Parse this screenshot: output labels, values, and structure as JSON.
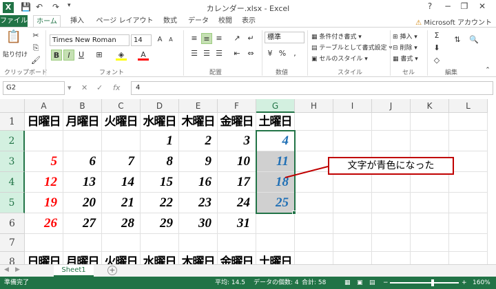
{
  "window": {
    "title": "カレンダー.xlsx - Excel",
    "logo": "X",
    "minimize": "−",
    "restore": "❐",
    "close": "✕",
    "help": "?"
  },
  "qat": {
    "save_icon": "save-icon",
    "undo_icon": "undo-icon",
    "redo_icon": "redo-icon"
  },
  "tabs": [
    "ファイル",
    "ホーム",
    "挿入",
    "ページ レイアウト",
    "数式",
    "データ",
    "校閲",
    "表示"
  ],
  "account": "Microsoft アカウント",
  "ribbon": {
    "clipboard": {
      "paste": "貼り付け",
      "label": "クリップボード"
    },
    "font": {
      "name": "Times New Roman",
      "size": "14",
      "bold": "B",
      "italic": "I",
      "underline": "U",
      "label": "フォント"
    },
    "alignment": {
      "label": "配置"
    },
    "number": {
      "format": "標準",
      "label": "数値"
    },
    "styles": {
      "conditional": "条件付き書式",
      "table": "テーブルとして書式設定",
      "cell": "セルのスタイル",
      "label": "スタイル"
    },
    "cells": {
      "insert": "挿入",
      "delete": "削除",
      "format": "書式",
      "label": "セル"
    },
    "editing": {
      "label": "編集"
    }
  },
  "formula_bar": {
    "namebox": "G2",
    "fx": "fx",
    "value": "4"
  },
  "grid": {
    "columns": [
      "A",
      "B",
      "C",
      "D",
      "E",
      "F",
      "G",
      "H",
      "I",
      "J",
      "K",
      "L"
    ],
    "rows": [
      "1",
      "2",
      "3",
      "4",
      "5",
      "6",
      "7",
      "8"
    ],
    "selected_column": "G",
    "selected_rows": [
      "2",
      "3",
      "4",
      "5"
    ],
    "weekdays": [
      "日曜日",
      "月曜日",
      "火曜日",
      "水曜日",
      "木曜日",
      "金曜日",
      "土曜日"
    ],
    "weeks": [
      [
        "",
        "",
        "",
        "1",
        "2",
        "3",
        "4"
      ],
      [
        "5",
        "6",
        "7",
        "8",
        "9",
        "10",
        "11"
      ],
      [
        "12",
        "13",
        "14",
        "15",
        "16",
        "17",
        "18"
      ],
      [
        "19",
        "20",
        "21",
        "22",
        "23",
        "24",
        "25"
      ],
      [
        "26",
        "27",
        "28",
        "29",
        "30",
        "31",
        ""
      ]
    ],
    "row8_weekdays": [
      "日曜日",
      "月曜日",
      "火曜日",
      "水曜日",
      "木曜日",
      "金曜日",
      "土曜日"
    ]
  },
  "colors": {
    "sunday": "#ff0000",
    "saturday": "#1f6fb5",
    "accent": "#217346",
    "callout_border": "#c00000"
  },
  "callout": "文字が青色になった",
  "sheets": {
    "active": "Sheet1",
    "add": "+"
  },
  "status": {
    "ready": "準備完了",
    "average": "平均: 14.5",
    "count": "データの個数: 4",
    "sum": "合計: 58",
    "zoom": "160%"
  }
}
